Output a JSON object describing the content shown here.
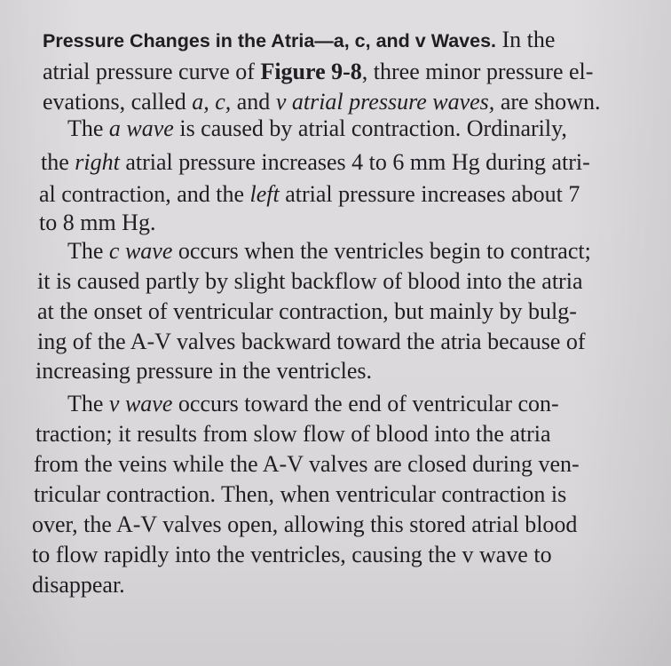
{
  "section": {
    "heading": "Pressure Changes in the Atria—a, c, and v Waves.",
    "paragraphs": [
      {
        "lines": [
          [
            {
              "t": "Pressure Changes in the Atria—a, c, and v Waves.",
              "s": "heading"
            },
            {
              "t": " In the"
            }
          ],
          [
            {
              "t": "atrial pressure curve of "
            },
            {
              "t": "Figure 9-8",
              "s": "bold"
            },
            {
              "t": ", three minor pressure el-"
            }
          ],
          [
            {
              "t": "evations, called "
            },
            {
              "t": "a, c,",
              "s": "it"
            },
            {
              "t": " and "
            },
            {
              "t": "v atrial pressure waves,",
              "s": "it"
            },
            {
              "t": " are shown."
            }
          ]
        ]
      },
      {
        "lines": [
          [
            {
              "t": "    The "
            },
            {
              "t": "a wave",
              "s": "it"
            },
            {
              "t": " is caused by atrial contraction. Ordinarily,"
            }
          ],
          [
            {
              "t": "the "
            },
            {
              "t": "right",
              "s": "it"
            },
            {
              "t": " atrial pressure increases 4 to 6 mm Hg during atri-"
            }
          ],
          [
            {
              "t": "al contraction, and the "
            },
            {
              "t": "left",
              "s": "it"
            },
            {
              "t": " atrial pressure increases about 7"
            }
          ],
          [
            {
              "t": "to 8 mm Hg."
            }
          ]
        ]
      },
      {
        "lines": [
          [
            {
              "t": "    The "
            },
            {
              "t": "c wave",
              "s": "it"
            },
            {
              "t": " occurs when the ventricles begin to contract;"
            }
          ],
          [
            {
              "t": "it is caused partly by slight backflow of blood into the atria"
            }
          ],
          [
            {
              "t": "at the onset of ventricular contraction, but mainly by bulg-"
            }
          ],
          [
            {
              "t": "ing of the A-V valves backward toward the atria because of"
            }
          ],
          [
            {
              "t": "increasing pressure in the ventricles."
            }
          ]
        ]
      },
      {
        "lines": [
          [
            {
              "t": "    The "
            },
            {
              "t": "v wave",
              "s": "it"
            },
            {
              "t": " occurs toward the end of ventricular con-"
            }
          ],
          [
            {
              "t": "traction; it results from slow flow of blood into the atria"
            }
          ],
          [
            {
              "t": "from the veins while the A-V valves are closed during ven-"
            }
          ],
          [
            {
              "t": "tricular contraction. Then, when ventricular contraction is"
            }
          ],
          [
            {
              "t": "over, the A-V valves open, allowing this stored atrial blood"
            }
          ],
          [
            {
              "t": "to flow rapidly into the ventricles, causing the v wave to"
            }
          ],
          [
            {
              "t": "disappear."
            }
          ]
        ]
      }
    ]
  }
}
